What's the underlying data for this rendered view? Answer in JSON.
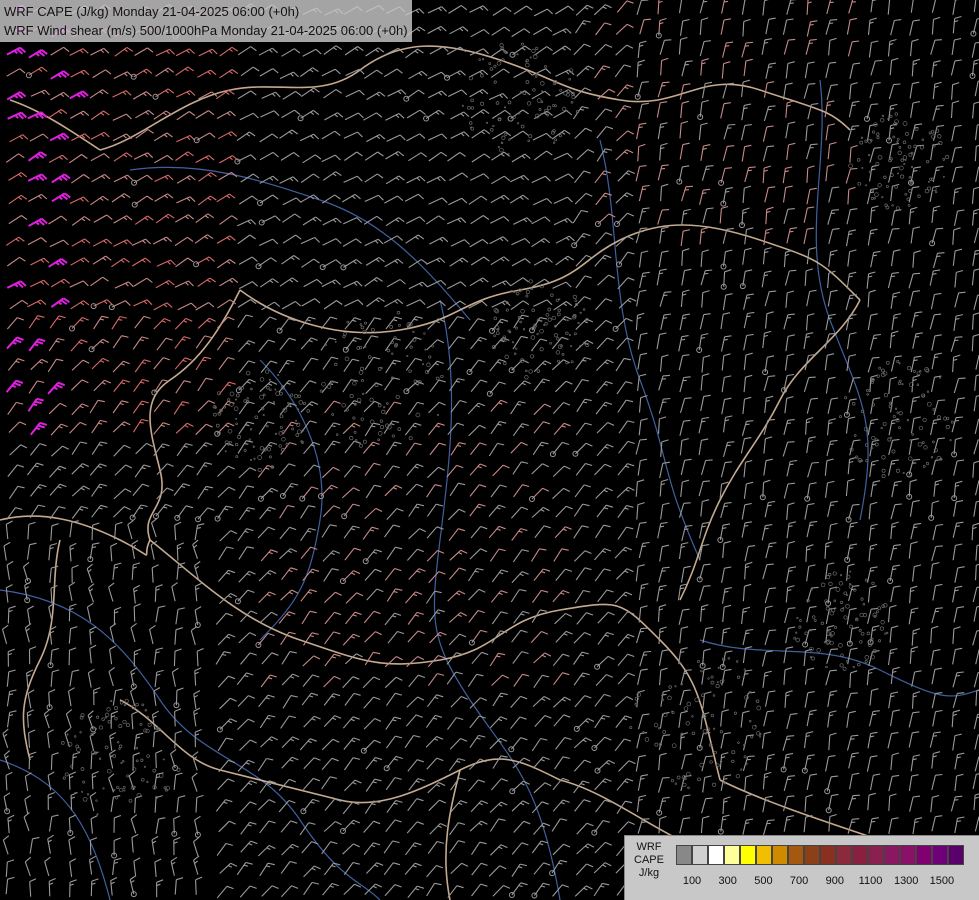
{
  "header": {
    "line1": "WRF CAPE (J/kg) Monday 21-04-2025 06:00 (+0h)",
    "line2": "WRF Wind shear (m/s) 500/1000hPa Monday 21-04-2025 06:00 (+0h)"
  },
  "legend": {
    "title_lines": [
      "WRF",
      "CAPE",
      "J/kg"
    ],
    "colors": [
      "#888888",
      "#d0d0d0",
      "#ffffff",
      "#ffff9a",
      "#ffff00",
      "#f0c000",
      "#d08a00",
      "#a35a10",
      "#8a4018",
      "#8a3020",
      "#8a2a3a",
      "#8a2040",
      "#8a2050",
      "#8a1860",
      "#8a1068",
      "#800070",
      "#70007a",
      "#5a006a"
    ],
    "tick_labels": [
      "100",
      "300",
      "500",
      "700",
      "900",
      "1100",
      "1300",
      "1500"
    ]
  },
  "map": {
    "background": "#000000",
    "border_color": "#e8c8a8",
    "river_color": "#4060a0",
    "barb_colors": {
      "low": "#9a9a9a",
      "mid": "#c88a88",
      "high": "#d86a6a",
      "extreme": "#e020e0"
    }
  }
}
